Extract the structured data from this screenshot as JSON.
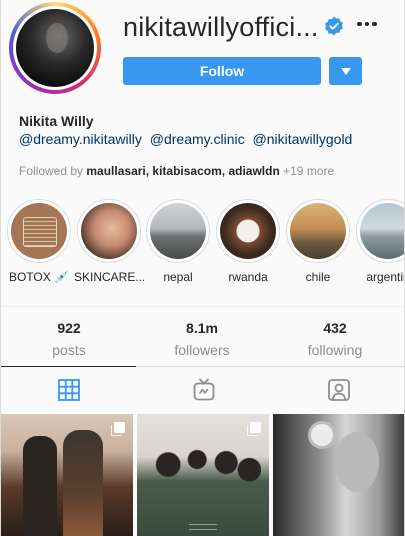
{
  "profile": {
    "username": "nikitawillyoffici...",
    "verified_icon": "verified-badge-icon",
    "follow_label": "Follow",
    "full_name": "Nikita Willy",
    "bio_mentions": [
      "@dreamy.nikitawilly",
      "@dreamy.clinic",
      "@nikitawillygold"
    ],
    "followed_by_prefix": "Followed by",
    "followed_by_users": "maullasari, kitabisacom, adiawldn",
    "followed_by_more": "+19 more"
  },
  "highlights": [
    {
      "label": "BOTOX 💉"
    },
    {
      "label": "SKINCARE..."
    },
    {
      "label": "nepal"
    },
    {
      "label": "rwanda"
    },
    {
      "label": "chile"
    },
    {
      "label": "argentin"
    }
  ],
  "stats": {
    "posts_count": "922",
    "posts_label": "posts",
    "followers_count": "8.1m",
    "followers_label": "followers",
    "following_count": "432",
    "following_label": "following"
  },
  "tabs": [
    {
      "icon": "grid-icon",
      "active": true
    },
    {
      "icon": "igtv-icon",
      "active": false
    },
    {
      "icon": "tagged-icon",
      "active": false
    }
  ],
  "colors": {
    "accent": "#3897f0",
    "link": "#003569",
    "muted": "#8e8e8e",
    "text": "#262626"
  }
}
